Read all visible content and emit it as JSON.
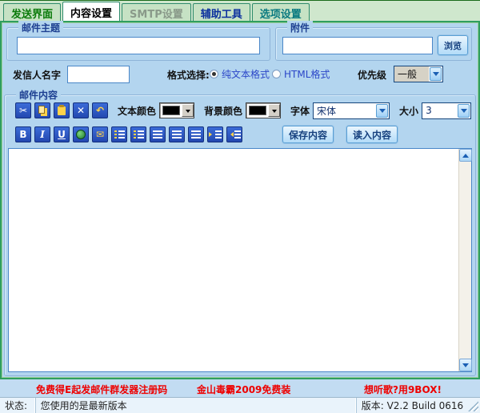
{
  "tabs": [
    {
      "label": "发送界面",
      "active": false
    },
    {
      "label": "内容设置",
      "active": true
    },
    {
      "label": "SMTP设置",
      "active": false
    },
    {
      "label": "辅助工具",
      "active": false
    },
    {
      "label": "选项设置",
      "active": false
    }
  ],
  "subject_group": {
    "title": "邮件主题",
    "value": ""
  },
  "attachment_group": {
    "title": "附件",
    "value": "",
    "browse_label": "浏览"
  },
  "sender_row": {
    "name_label": "发信人名字",
    "name_value": "",
    "format_label": "格式选择:",
    "format_options": [
      {
        "label": "纯文本格式",
        "selected": true
      },
      {
        "label": "HTML格式",
        "selected": false
      }
    ],
    "priority_label": "优先级",
    "priority_value": "一般"
  },
  "content_group": {
    "title": "邮件内容",
    "toolbar1": {
      "icon_names": [
        "cut-icon",
        "copy-icon",
        "paste-icon",
        "delete-icon",
        "undo-icon"
      ],
      "cut_glyph": "✂",
      "delete_glyph": "✕",
      "undo_glyph": "↶",
      "text_color_label": "文本颜色",
      "text_color_value": "#000000",
      "bg_color_label": "背景颜色",
      "bg_color_value": "#000000",
      "font_label": "字体",
      "font_value": "宋体",
      "size_label": "大小",
      "size_value": "3"
    },
    "toolbar2": {
      "icon_names": [
        "bold-icon",
        "italic-icon",
        "underline-icon",
        "insert-link-icon",
        "mail-link-icon",
        "ordered-list-icon",
        "bullet-list-icon",
        "align-left-icon",
        "align-center-icon",
        "align-right-icon",
        "indent-icon",
        "outdent-icon"
      ],
      "bold_glyph": "B",
      "italic_glyph": "I",
      "underline_glyph": "U",
      "mail_glyph": "✉",
      "save_label": "保存内容",
      "load_label": "读入内容"
    },
    "editor_value": ""
  },
  "promo_links": [
    "免费得E起发邮件群发器注册码",
    "金山毒霸2009免费装",
    "想听歌?用9BOX!"
  ],
  "status_bar": {
    "status_label": "状态:",
    "status_text": "您使用的是最新版本",
    "version_text": "版本: V2.2 Build 0616"
  },
  "colors": {
    "page_background": "#b3d5ef",
    "tab_strip_background": "#cfe7cd",
    "frame_green": "#2f9e5f",
    "toolbar_icon_blue": "#2348b0",
    "link_red": "#ee0000"
  }
}
